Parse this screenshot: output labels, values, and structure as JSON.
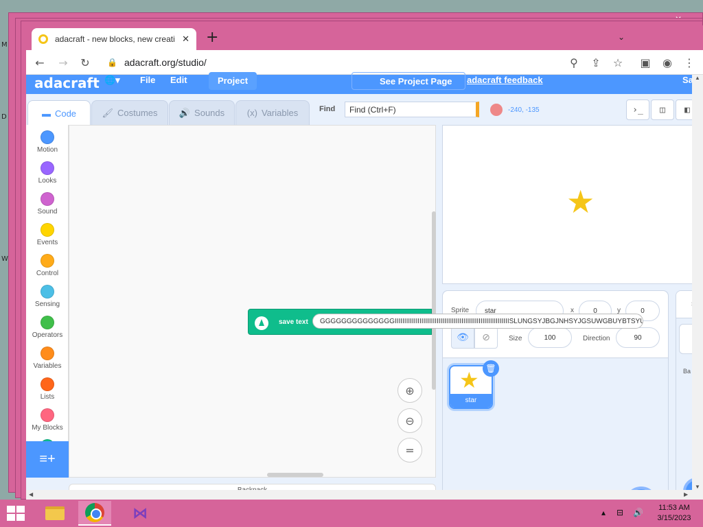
{
  "desktop": {
    "letters": [
      "M",
      "D",
      "W"
    ]
  },
  "browser": {
    "tab_title": "adacraft - new blocks, new creati",
    "tab_close": "✕",
    "new_tab": "+",
    "tab_menu": "⌄",
    "url": "adacraft.org/studio/",
    "window_controls": {
      "minimize": "—",
      "maximize": "☐",
      "close": "✕"
    }
  },
  "app": {
    "logo": "adacraft",
    "menu": {
      "language": "🌐▾",
      "file": "File",
      "edit": "Edit",
      "project": "Project",
      "see_project": "See Project Page",
      "feedback": "adacraft feedback",
      "save_partial": "Sa"
    },
    "tabs": [
      {
        "label": "Code",
        "icon": "code-icon",
        "glyph": "▬"
      },
      {
        "label": "Costumes",
        "icon": "brush-icon",
        "glyph": "🖌"
      },
      {
        "label": "Sounds",
        "icon": "speaker-icon",
        "glyph": "🔊"
      },
      {
        "label": "Variables",
        "icon": "variable-icon",
        "glyph": "(x)"
      }
    ],
    "find_label": "Find",
    "find_placeholder": "Find (Ctrl+F)",
    "coords": "-240, -135",
    "view_buttons": [
      "›_",
      "◫",
      "◧"
    ],
    "categories": [
      {
        "label": "Motion",
        "color": "#4c97ff"
      },
      {
        "label": "Looks",
        "color": "#9966ff"
      },
      {
        "label": "Sound",
        "color": "#cf63cf"
      },
      {
        "label": "Events",
        "color": "#ffd500"
      },
      {
        "label": "Control",
        "color": "#ffab19"
      },
      {
        "label": "Sensing",
        "color": "#4cbfe6"
      },
      {
        "label": "Operators",
        "color": "#40bf4a"
      },
      {
        "label": "Variables",
        "color": "#ff8c1a"
      },
      {
        "label": "Lists",
        "color": "#ff661a"
      },
      {
        "label": "My Blocks",
        "color": "#ff6680"
      }
    ],
    "extension_button": "≡+",
    "block": {
      "label": "save text",
      "value": "GGGGGGGGGGGGGGIIIIIIIIIIIIIIIIIIIIIIIIIIIIIIIIIIIIIIIIIIIIIIIIIIIIIIIIIIIISLUNGSYJBGJNHSYJGSUWGBUYBTSYUgfu"
    },
    "zoom": {
      "zoom_in": "⊕",
      "zoom_out": "⊖",
      "reset": "="
    },
    "sprite": {
      "sprite_label": "Sprite",
      "name": "star",
      "x_label": "x",
      "x": "0",
      "y_label": "y",
      "y": "0",
      "show_visible": "👁",
      "show_hidden": "⊘",
      "size_label": "Size",
      "size": "100",
      "direction_label": "Direction",
      "direction": "90",
      "thumb_label": "star",
      "delete": "🗑"
    },
    "stage_pane": {
      "head": "S",
      "backdrop_label": "Ba"
    },
    "add_sprite": "🐱",
    "backpack": "Backpack"
  },
  "taskbar": {
    "time": "11:53 AM",
    "date": "3/15/2023",
    "tray": {
      "up": "▴",
      "network": "⊟",
      "volume": "🔊"
    }
  },
  "colors": {
    "accent": "#4c97ff",
    "window_chrome": "#d6649a",
    "block_green": "#0fbd8c",
    "star": "#f5c518"
  }
}
